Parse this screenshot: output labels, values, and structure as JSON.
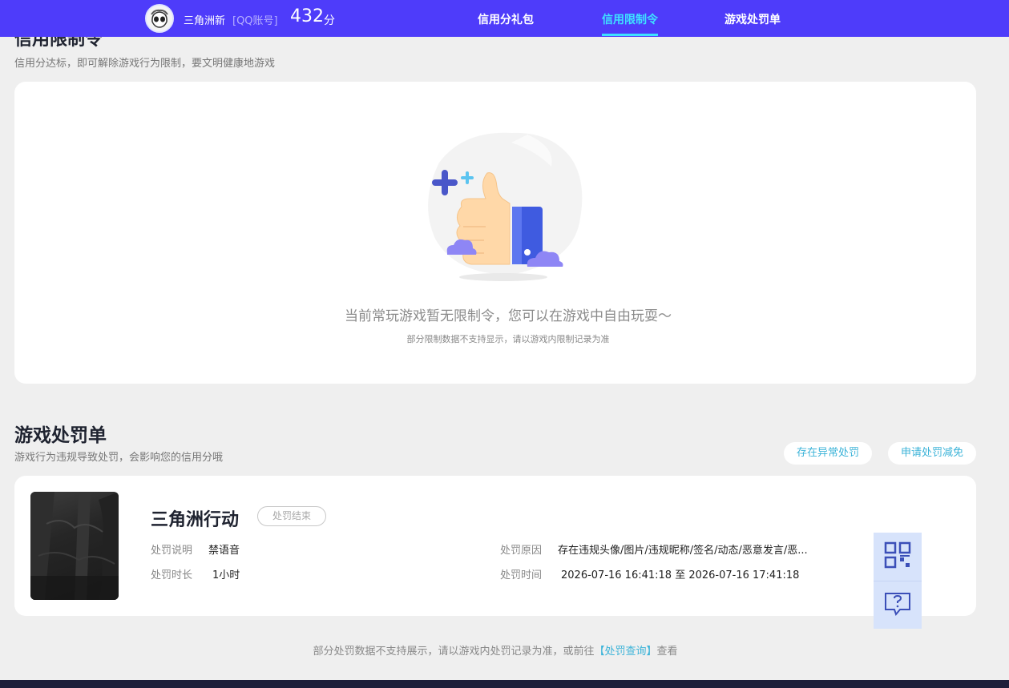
{
  "header": {
    "user_name": "三角洲新",
    "account_type": "[QQ账号]",
    "score": "432",
    "score_unit": "分",
    "tabs": [
      {
        "label": "信用分礼包",
        "active": false
      },
      {
        "label": "信用限制令",
        "active": true
      },
      {
        "label": "游戏处罚单",
        "active": false
      }
    ],
    "brand_color": "#4e3cfa",
    "active_tab_color": "#3ee2ff"
  },
  "restriction": {
    "title": "信用限制令",
    "subtitle": "信用分达标，即可解除游戏行为限制，要文明健康地游戏",
    "empty_message": "当前常玩游戏暂无限制令，您可以在游戏中自由玩耍～",
    "empty_note": "部分限制数据不支持显示，请以游戏内限制记录为准"
  },
  "penalty": {
    "title": "游戏处罚单",
    "subtitle": "游戏行为违规导致处罚，会影响您的信用分哦",
    "buttons": {
      "abnormal": "存在异常处罚",
      "reduce": "申请处罚减免"
    },
    "record": {
      "game_name": "三角洲行动",
      "status": "处罚结束",
      "desc_label": "处罚说明",
      "desc_value": "禁语音",
      "duration_label": "处罚时长",
      "duration_value": "1小时",
      "reason_label": "处罚原因",
      "reason_value": "存在违规头像/图片/违规昵称/签名/动态/恶意发言/恶...",
      "time_label": "处罚时间",
      "time_value": "2026-07-16 16:41:18 至 2026-07-16 17:41:18"
    },
    "footer_note": "部分处罚数据不支持展示，请以游戏内处罚记录为准，或前往",
    "footer_link": "【处罚查询】",
    "footer_tail": "查看"
  },
  "side_tools": [
    "qr-code-icon",
    "feedback-icon"
  ]
}
